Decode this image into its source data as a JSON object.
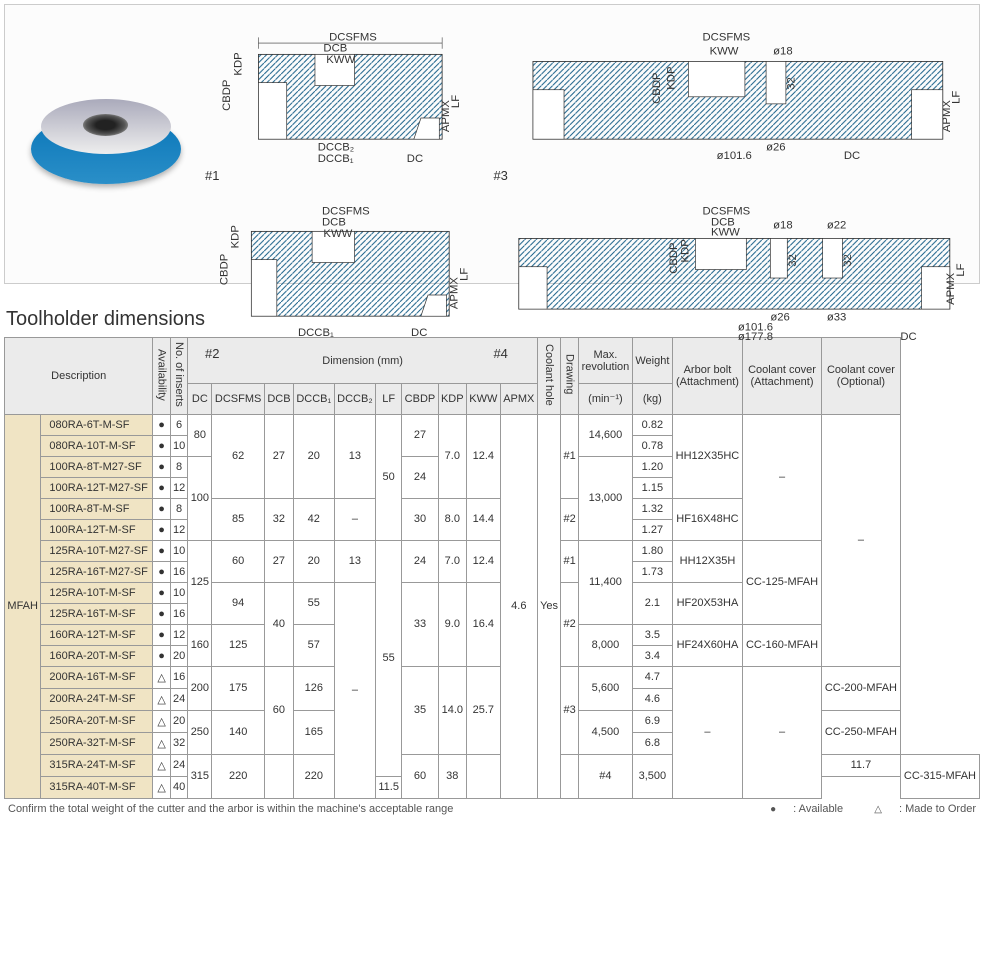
{
  "diagramLabels": {
    "d1": "#1",
    "d2": "#2",
    "d3": "#3",
    "d4": "#4"
  },
  "dimText": {
    "DCSFMS": "DCSFMS",
    "DCB": "DCB",
    "KWW": "KWW",
    "KDP": "KDP",
    "CBDP": "CBDP",
    "LF": "LF",
    "APMX": "APMX",
    "DC": "DC",
    "DCCB1": "DCCB₁",
    "DCCB2": "DCCB₂",
    "d18": "ø18",
    "d22": "ø22",
    "d26": "ø26",
    "d33": "ø33",
    "d1016": "ø101.6",
    "d1778": "ø177.8",
    "v32": "32"
  },
  "section": {
    "title": "Toolholder dimensions"
  },
  "headers": {
    "desc": "Description",
    "avail": "Availability",
    "inserts": "No. of inserts",
    "dimgrp": "Dimension (mm)",
    "DC": "DC",
    "DCSFMS": "DCSFMS",
    "DCB": "DCB",
    "DCCB1": "DCCB₁",
    "DCCB2": "DCCB₂",
    "LF": "LF",
    "CBDP": "CBDP",
    "KDP": "KDP",
    "KWW": "KWW",
    "APMX": "APMX",
    "coolant": "Coolant hole",
    "drawing": "Drawing",
    "maxrev": "Max.\nrevolution",
    "maxrevUnit": "(min⁻¹)",
    "weight": "Weight",
    "weightUnit": "(kg)",
    "arbor": "Arbor bolt\n(Attachment)",
    "ccoverA": "Coolant cover\n(Attachment)",
    "ccoverO": "Coolant cover\n(Optional)"
  },
  "family": "MFAH",
  "rows": [
    {
      "model": "080RA-6T-M-SF",
      "avail": "●",
      "ins": "6",
      "weight": "0.82"
    },
    {
      "model": "080RA-10T-M-SF",
      "avail": "●",
      "ins": "10",
      "weight": "0.78"
    },
    {
      "model": "100RA-8T-M27-SF",
      "avail": "●",
      "ins": "8",
      "weight": "1.20"
    },
    {
      "model": "100RA-12T-M27-SF",
      "avail": "●",
      "ins": "12",
      "weight": "1.15"
    },
    {
      "model": "100RA-8T-M-SF",
      "avail": "●",
      "ins": "8",
      "weight": "1.32"
    },
    {
      "model": "100RA-12T-M-SF",
      "avail": "●",
      "ins": "12",
      "weight": "1.27"
    },
    {
      "model": "125RA-10T-M27-SF",
      "avail": "●",
      "ins": "10",
      "weight": "1.80"
    },
    {
      "model": "125RA-16T-M27-SF",
      "avail": "●",
      "ins": "16",
      "weight": "1.73"
    },
    {
      "model": "125RA-10T-M-SF",
      "avail": "●",
      "ins": "10",
      "weight": "2.1"
    },
    {
      "model": "125RA-16T-M-SF",
      "avail": "●",
      "ins": "16",
      "weight": "2.1"
    },
    {
      "model": "160RA-12T-M-SF",
      "avail": "●",
      "ins": "12",
      "weight": "3.5"
    },
    {
      "model": "160RA-20T-M-SF",
      "avail": "●",
      "ins": "20",
      "weight": "3.4"
    },
    {
      "model": "200RA-16T-M-SF",
      "avail": "△",
      "ins": "16",
      "weight": "4.7"
    },
    {
      "model": "200RA-24T-M-SF",
      "avail": "△",
      "ins": "24",
      "weight": "4.6"
    },
    {
      "model": "250RA-20T-M-SF",
      "avail": "△",
      "ins": "20",
      "weight": "6.9"
    },
    {
      "model": "250RA-32T-M-SF",
      "avail": "△",
      "ins": "32",
      "weight": "6.8"
    },
    {
      "model": "315RA-24T-M-SF",
      "avail": "△",
      "ins": "24",
      "weight": "11.7"
    },
    {
      "model": "315RA-40T-M-SF",
      "avail": "△",
      "ins": "40",
      "weight": "11.5"
    }
  ],
  "cells": {
    "DC_80": "80",
    "DC_100": "100",
    "DC_125": "125",
    "DC_160": "160",
    "DC_200": "200",
    "DC_250": "250",
    "DC_315": "315",
    "DCSFMS_62": "62",
    "DCSFMS_85": "85",
    "DCSFMS_60": "60",
    "DCSFMS_94": "94",
    "DCSFMS_125": "125",
    "DCSFMS_175": "175",
    "DCSFMS_140": "140",
    "DCSFMS_220": "220",
    "DCB_27": "27",
    "DCB_32": "32",
    "DCB_40": "40",
    "DCB_60": "60",
    "DCCB1_20": "20",
    "DCCB1_42": "42",
    "DCCB1_55": "55",
    "DCCB1_57": "57",
    "DCCB1_126": "126",
    "DCCB1_165": "165",
    "DCCB1_220": "220",
    "DCCB2_13": "13",
    "DCCB2_dash": "–",
    "LF_50": "50",
    "LF_55": "55",
    "LF_60": "60",
    "CBDP_27": "27",
    "CBDP_24": "24",
    "CBDP_30": "30",
    "CBDP_33": "33",
    "CBDP_35": "35",
    "CBDP_38": "38",
    "KDP_70": "7.0",
    "KDP_80": "8.0",
    "KDP_90": "9.0",
    "KDP_140": "14.0",
    "KWW_124": "12.4",
    "KWW_144": "14.4",
    "KWW_164": "16.4",
    "KWW_257": "25.7",
    "APMX": "4.6",
    "coolant": "Yes",
    "drw1": "#1",
    "drw2": "#2",
    "drw3": "#3",
    "drw4": "#4",
    "rev_14600": "14,600",
    "rev_13000": "13,000",
    "rev_11400": "11,400",
    "rev_8000": "8,000",
    "rev_5600": "5,600",
    "rev_4500": "4,500",
    "rev_3500": "3,500",
    "arb_HH12X35HC": "HH12X35HC",
    "arb_HF16X48HC": "HF16X48HC",
    "arb_HH12X35H": "HH12X35H",
    "arb_HF20X53HA": "HF20X53HA",
    "arb_HF24X60HA": "HF24X60HA",
    "arb_dash": "–",
    "cca_dash": "–",
    "cca_125": "CC-125-MFAH",
    "cca_160": "CC-160-MFAH",
    "cco_dash": "–",
    "cco_200": "CC-200-MFAH",
    "cco_250": "CC-250-MFAH",
    "cco_315": "CC-315-MFAH"
  },
  "footnote": {
    "text": "Confirm the total weight of the cutter and the arbor is within the machine's acceptable range",
    "legendAvail": ": Available",
    "legendOrder": ": Made to Order"
  }
}
